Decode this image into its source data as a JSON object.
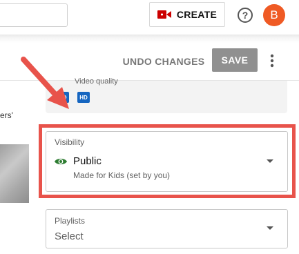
{
  "header": {
    "create_label": "CREATE",
    "avatar_letter": "B",
    "create_icon": "video-camera-icon",
    "help_icon": "question-circle-icon",
    "brand_red": "#cc0000",
    "avatar_color": "#ef5a24"
  },
  "toolbar": {
    "undo_label": "UNDO CHANGES",
    "save_label": "SAVE",
    "more_icon": "vertical-dots-icon"
  },
  "quality": {
    "label": "Video quality",
    "badges": [
      "SD",
      "HD"
    ],
    "badge_color": "#1565c0"
  },
  "side": {
    "partial_text": "ers'"
  },
  "visibility": {
    "label": "Visibility",
    "value": "Public",
    "sublabel": "Made for Kids (set by you)",
    "icon": "eye-icon",
    "icon_color": "#2e7d32"
  },
  "playlists": {
    "label": "Playlists",
    "value": "Select"
  },
  "annotation": {
    "color": "#e8534b"
  }
}
